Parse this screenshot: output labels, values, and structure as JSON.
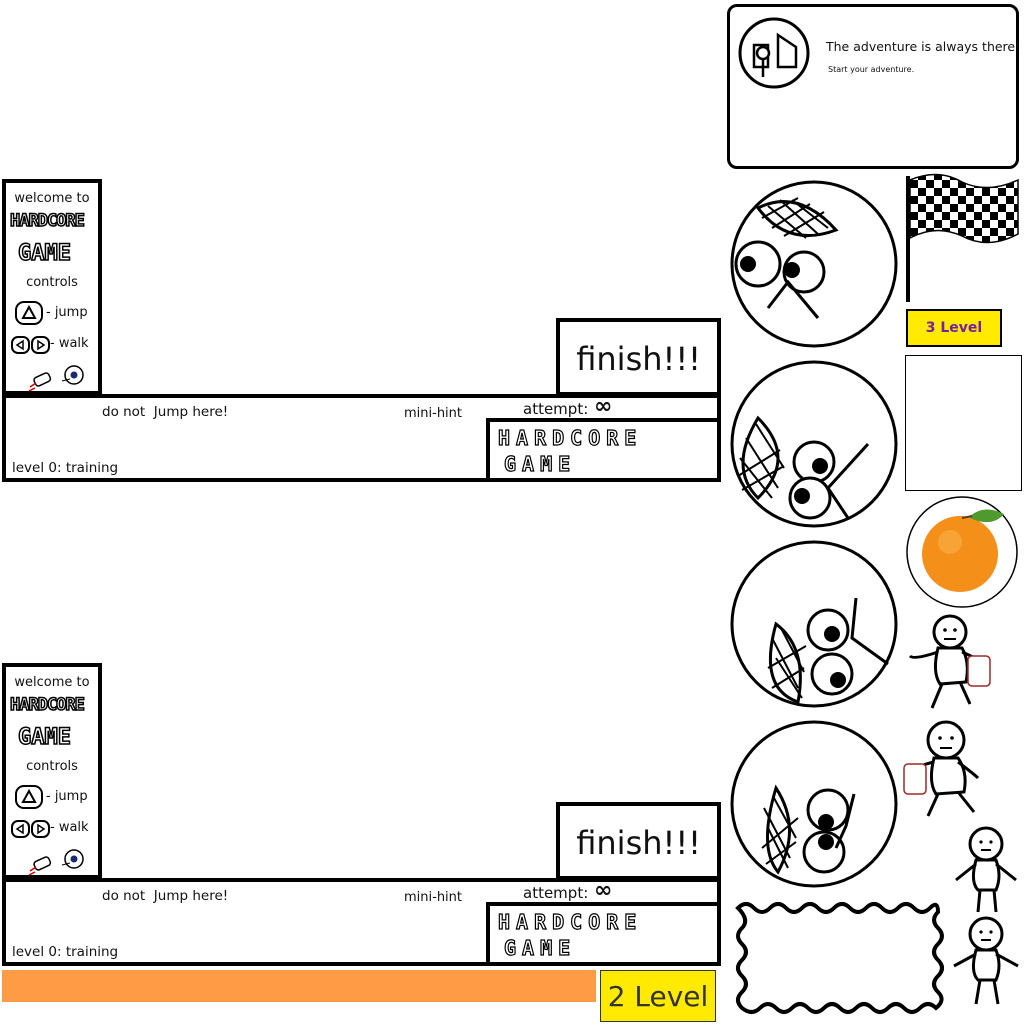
{
  "adventure": {
    "title": "The adventure is always there!",
    "subtitle": "Start your adventure."
  },
  "panels": [
    {
      "welcome": "welcome to",
      "logo_line1": "HARDCORE",
      "logo_line2": "GAME",
      "controls": "controls",
      "jump": "- jump",
      "walk": "- walk",
      "finish": "finish!!!",
      "warning": "do not  Jump here!",
      "hint": "mini-hint",
      "attempt": "attempt:",
      "attempt_value": "∞",
      "level_name": "level 0: training",
      "brand_line1": "HARDCORE",
      "brand_line2": "GAME"
    },
    {
      "welcome": "welcome to",
      "logo_line1": "HARDCORE",
      "logo_line2": "GAME",
      "controls": "controls",
      "jump": "- jump",
      "walk": "- walk",
      "finish": "finish!!!",
      "warning": "do not  Jump here!",
      "hint": "mini-hint",
      "attempt": "attempt:",
      "attempt_value": "∞",
      "level_name": "level 0: training",
      "brand_line1": "HARDCORE",
      "brand_line2": "GAME"
    }
  ],
  "level_badges": {
    "small": "3 Level",
    "large": "2 Level"
  },
  "colors": {
    "badge_yellow": "#ffea00",
    "progress_orange": "#ff9a45",
    "badge_text_purple": "#7a1fa0"
  }
}
